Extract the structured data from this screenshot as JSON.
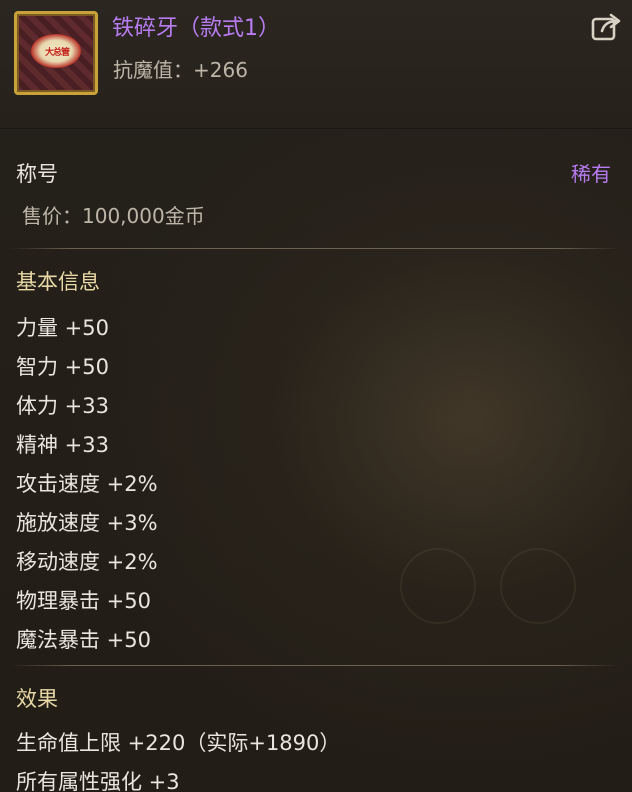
{
  "item": {
    "name": "铁碎牙（款式1）",
    "sub_stat": "抗魔值：+266",
    "icon_text": "大总管",
    "icon": "item-emblem-icon"
  },
  "header": {
    "share_icon": "share-external-icon"
  },
  "summary": {
    "type_label": "称号",
    "rarity": "稀有",
    "price": "售价：100,000金币"
  },
  "basic_info": {
    "title": "基本信息",
    "stats": [
      "力量 +50",
      "智力 +50",
      "体力 +33",
      "精神 +33",
      "攻击速度 +2%",
      "施放速度 +3%",
      "移动速度 +2%",
      "物理暴击 +50",
      "魔法暴击 +50"
    ]
  },
  "effects": {
    "title": "效果",
    "lines": [
      "生命值上限 +220（实际+1890）",
      "所有属性强化 +3"
    ]
  },
  "colors": {
    "rarity_purple": "#b77cf2",
    "section_gold": "#e7d8a6",
    "text_main": "#eae6de",
    "text_dim": "#bdb6a8",
    "icon_border": "#c9a23a"
  }
}
